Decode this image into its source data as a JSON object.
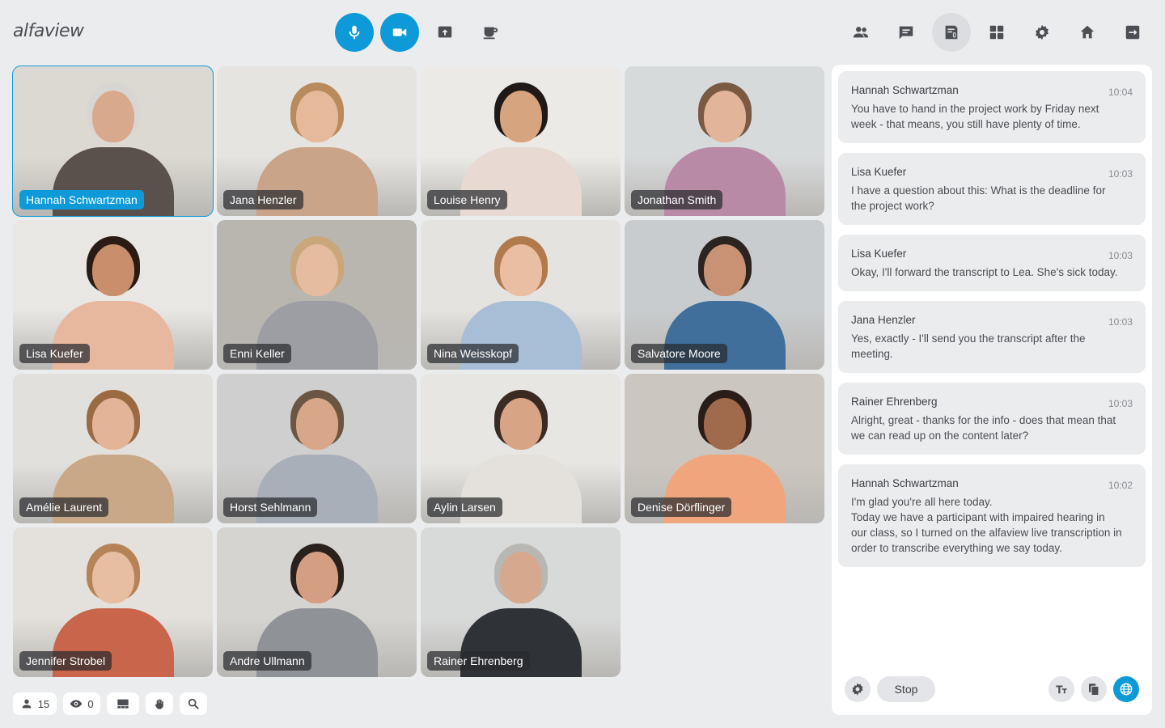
{
  "app": {
    "logo": "alfaview"
  },
  "colors": {
    "accent": "#0e9ad8",
    "background": "#ebecee",
    "panel": "#ffffff"
  },
  "toolbar": {
    "left": [
      {
        "id": "mic",
        "icon": "microphone-icon",
        "active": true
      },
      {
        "id": "camera",
        "icon": "video-camera-icon",
        "active": true
      },
      {
        "id": "share",
        "icon": "screen-share-icon"
      },
      {
        "id": "break",
        "icon": "coffee-cup-icon"
      }
    ],
    "right": [
      {
        "id": "participants",
        "icon": "people-icon"
      },
      {
        "id": "chat",
        "icon": "chat-icon"
      },
      {
        "id": "transcription",
        "icon": "live-transcription-icon",
        "active": true
      },
      {
        "id": "layout",
        "icon": "grid-layout-icon"
      },
      {
        "id": "settings",
        "icon": "gear-icon"
      },
      {
        "id": "home",
        "icon": "home-icon"
      },
      {
        "id": "leave",
        "icon": "exit-icon"
      }
    ]
  },
  "participants": [
    {
      "name": "Hannah Schwartzman",
      "speaking": true,
      "bg": "#dcd9d2",
      "skin": "#d9a98c",
      "hair": "#d8d6d2",
      "shirt": "#5a514d"
    },
    {
      "name": "Jana Henzler",
      "bg": "#e6e4e0",
      "skin": "#e6b99a",
      "hair": "#b88a5c",
      "shirt": "#c9a488"
    },
    {
      "name": "Louise Henry",
      "bg": "#eceae6",
      "skin": "#d6a47e",
      "hair": "#1f1a17",
      "shirt": "#e9d9d3"
    },
    {
      "name": "Jonathan Smith",
      "bg": "#d7dadb",
      "skin": "#e2b49a",
      "hair": "#7a5a42",
      "shirt": "#b88aa6"
    },
    {
      "name": "Lisa Kuefer",
      "bg": "#e9e7e4",
      "skin": "#c98e6c",
      "hair": "#2a1c15",
      "shirt": "#e7b79e"
    },
    {
      "name": "Enni Keller",
      "bg": "#b9b6b0",
      "skin": "#e5bc9f",
      "hair": "#c9a77a",
      "shirt": "#9c9ea3"
    },
    {
      "name": "Nina Weisskopf",
      "bg": "#e4e3e0",
      "skin": "#e9bea3",
      "hair": "#b17a4c",
      "shirt": "#a8bdd6"
    },
    {
      "name": "Salvatore Moore",
      "bg": "#c9ccce",
      "skin": "#c99274",
      "hair": "#2b2420",
      "shirt": "#3f6f9a"
    },
    {
      "name": "Amélie Laurent",
      "bg": "#e2e0dc",
      "skin": "#e3b497",
      "hair": "#9a6a42",
      "shirt": "#c8a886"
    },
    {
      "name": "Horst Sehlmann",
      "bg": "#cfcfcf",
      "skin": "#d8a688",
      "hair": "#6b5644",
      "shirt": "#a9afb8"
    },
    {
      "name": "Aylin Larsen",
      "bg": "#e7e6e3",
      "skin": "#d7a585",
      "hair": "#3a2a22",
      "shirt": "#e4e1dc"
    },
    {
      "name": "Denise Dörflinger",
      "bg": "#cbc6bf",
      "skin": "#a06a4c",
      "hair": "#2a1d17",
      "shirt": "#f0a57c"
    },
    {
      "name": "Jennifer Strobel",
      "bg": "#e4e1dc",
      "skin": "#e8bea2",
      "hair": "#b58356",
      "shirt": "#c8654a"
    },
    {
      "name": "Andre Ullmann",
      "bg": "#d5d4d1",
      "skin": "#d49e82",
      "hair": "#2b211c",
      "shirt": "#8f9296"
    },
    {
      "name": "Rainer Ehrenberg",
      "bg": "#d8dad9",
      "skin": "#d6a88e",
      "hair": "#b9b7b3",
      "shirt": "#2f3338"
    }
  ],
  "status": {
    "participant_count": "15",
    "viewer_count": "0"
  },
  "messages": [
    {
      "author": "Hannah Schwartzman",
      "time": "10:04",
      "lines": [
        "You have to hand in the project work by Friday next",
        "week - that means, you still have plenty of time."
      ]
    },
    {
      "author": "Lisa Kuefer",
      "time": "10:03",
      "lines": [
        "I have a question about this: What is the deadline for",
        "the project work?"
      ]
    },
    {
      "author": "Lisa Kuefer",
      "time": "10:03",
      "lines": [
        "Okay, I'll forward the transcript to Lea. She's sick today."
      ]
    },
    {
      "author": "Jana Henzler",
      "time": "10:03",
      "lines": [
        "Yes, exactly - I'll send you the transcript after the",
        "meeting."
      ]
    },
    {
      "author": "Rainer Ehrenberg",
      "time": "10:03",
      "lines": [
        "Alright, great - thanks for the info - does that mean that",
        "we can read up on the content later?"
      ]
    },
    {
      "author": "Hannah Schwartzman",
      "time": "10:02",
      "lines": [
        "I'm glad you're all here today.",
        "Today we have a participant with impaired hearing in",
        "our class, so I turned on the alfaview live transcription in",
        "order to transcribe everything we say today."
      ]
    }
  ],
  "transcript_panel": {
    "stop_label": "Stop"
  }
}
